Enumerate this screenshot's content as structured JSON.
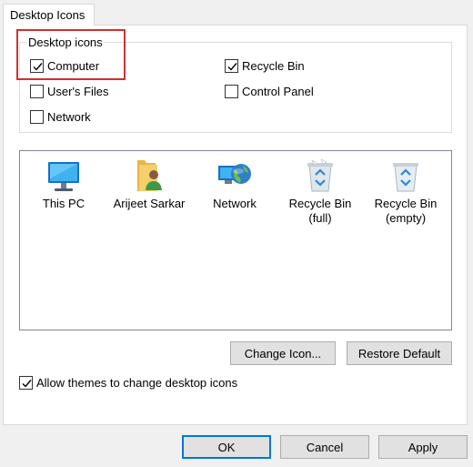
{
  "tab": {
    "label": "Desktop Icons"
  },
  "group": {
    "title": "Desktop icons",
    "checkboxes": [
      {
        "label": "Computer",
        "checked": true
      },
      {
        "label": "Recycle Bin",
        "checked": true
      },
      {
        "label": "User's Files",
        "checked": false
      },
      {
        "label": "Control Panel",
        "checked": false
      },
      {
        "label": "Network",
        "checked": false
      }
    ]
  },
  "icons": [
    {
      "label": "This PC",
      "icon": "monitor-icon"
    },
    {
      "label": "Arijeet Sarkar",
      "icon": "user-folder-icon"
    },
    {
      "label": "Network",
      "icon": "network-globe-icon"
    },
    {
      "label": "Recycle Bin (full)",
      "icon": "recycle-bin-full-icon"
    },
    {
      "label": "Recycle Bin (empty)",
      "icon": "recycle-bin-empty-icon"
    }
  ],
  "buttons": {
    "change_icon": "Change Icon...",
    "restore_default": "Restore Default",
    "ok": "OK",
    "cancel": "Cancel",
    "apply": "Apply"
  },
  "allow_themes": {
    "label": "Allow themes to change desktop icons",
    "checked": true
  },
  "colors": {
    "accent": "#0078d7",
    "highlight": "#d0302f"
  }
}
